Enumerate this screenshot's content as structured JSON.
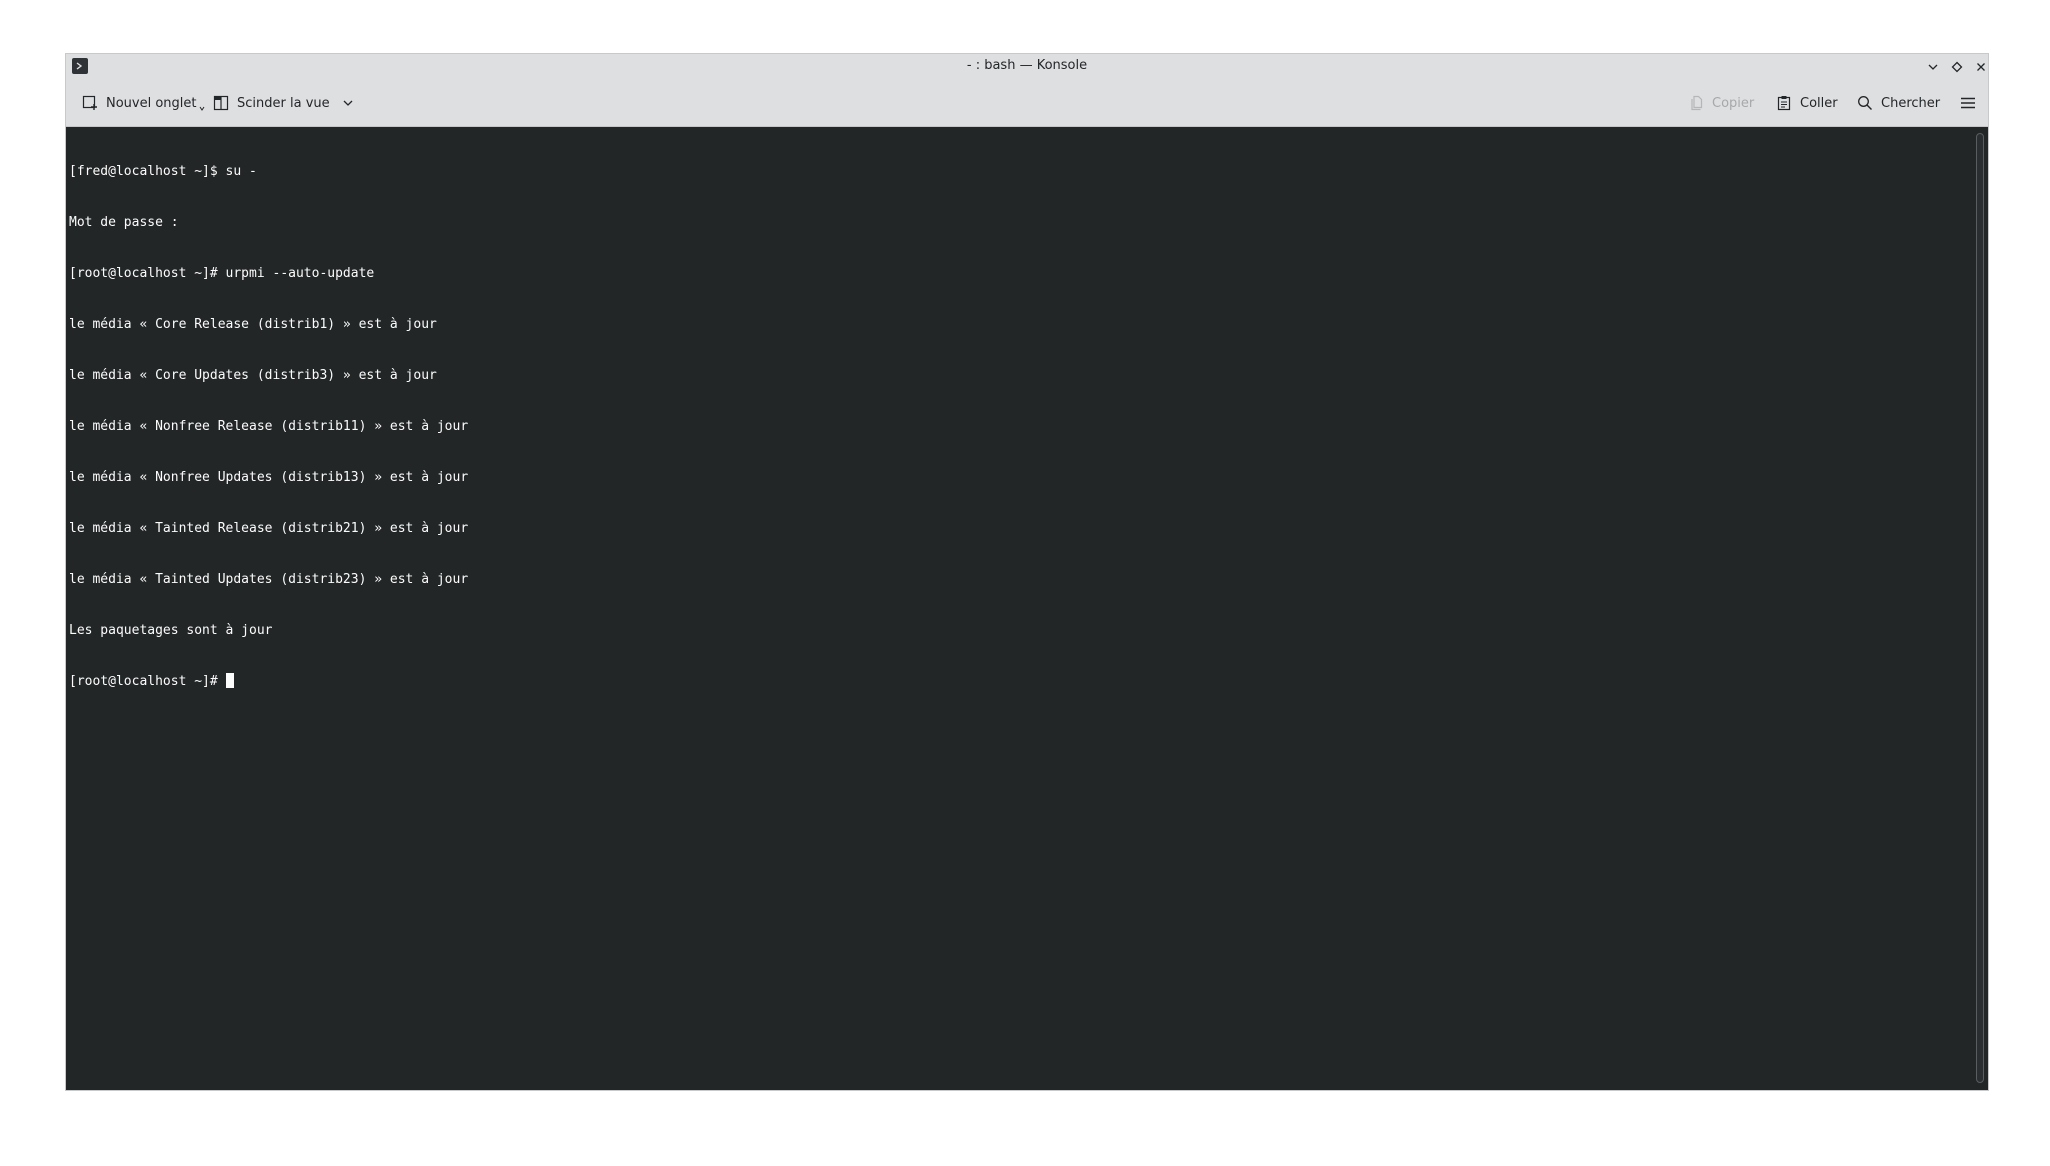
{
  "window": {
    "title": "- : bash — Konsole"
  },
  "toolbar": {
    "new_tab_label": "Nouvel onglet",
    "split_view_label": "Scinder la vue",
    "copy_label": "Copier",
    "paste_label": "Coller",
    "search_label": "Chercher"
  },
  "terminal": {
    "lines": [
      "[fred@localhost ~]$ su -",
      "Mot de passe :",
      "[root@localhost ~]# urpmi --auto-update",
      "le média « Core Release (distrib1) » est à jour",
      "le média « Core Updates (distrib3) » est à jour",
      "le média « Nonfree Release (distrib11) » est à jour",
      "le média « Nonfree Updates (distrib13) » est à jour",
      "le média « Tainted Release (distrib21) » est à jour",
      "le média « Tainted Updates (distrib23) » est à jour",
      "Les paquetages sont à jour"
    ],
    "prompt": "[root@localhost ~]# "
  },
  "icons": {
    "app": "terminal-icon",
    "new_tab": "new-tab-icon",
    "split": "split-view-icon",
    "copy": "copy-icon",
    "paste": "paste-icon",
    "search": "search-icon",
    "menu": "hamburger-menu-icon"
  },
  "colors": {
    "terminal_bg": "#232627",
    "terminal_fg": "#fcfcfc",
    "chrome_bg": "#dedfe1"
  }
}
